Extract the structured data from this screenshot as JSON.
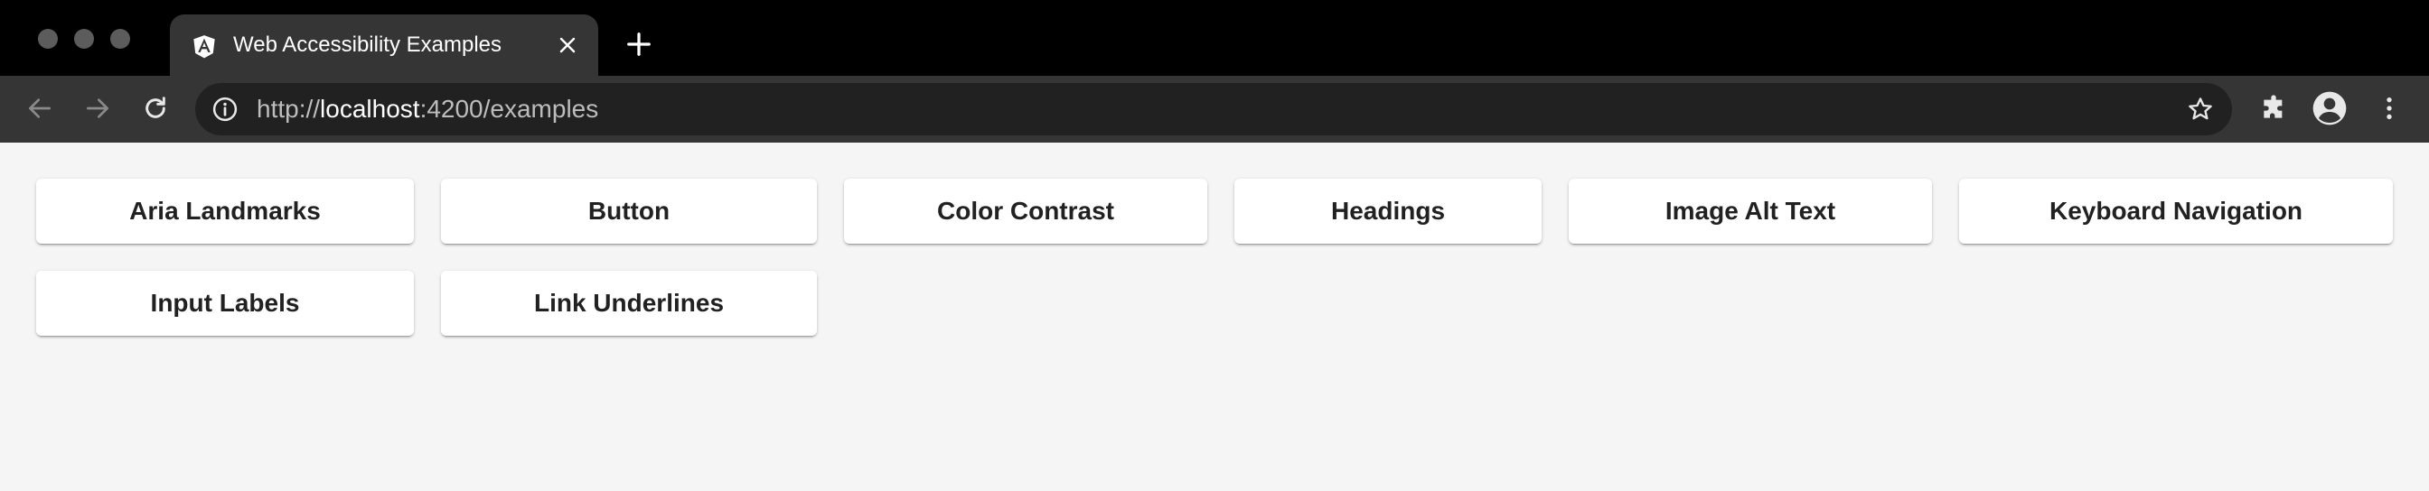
{
  "browser": {
    "tab": {
      "title": "Web Accessibility Examples",
      "favicon_icon": "angular-logo-icon",
      "close_icon": "close-icon"
    },
    "new_tab_icon": "plus-icon",
    "toolbar": {
      "back_icon": "arrow-left-icon",
      "forward_icon": "arrow-right-icon",
      "reload_icon": "reload-icon",
      "extensions_icon": "puzzle-icon",
      "profile_icon": "account-icon",
      "menu_icon": "kebab-menu-icon",
      "star_icon": "star-outline-icon",
      "info_icon": "info-icon"
    },
    "address": {
      "scheme": "http://",
      "host": "localhost",
      "rest": ":4200/examples"
    }
  },
  "page": {
    "buttons": [
      "Aria Landmarks",
      "Button",
      "Color Contrast",
      "Headings",
      "Image Alt Text",
      "Keyboard Navigation",
      "Input Labels",
      "Link Underlines"
    ]
  }
}
